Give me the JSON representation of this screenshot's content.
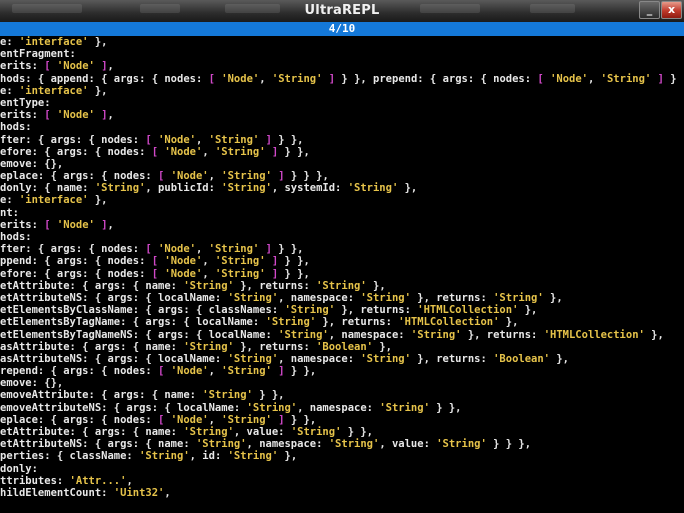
{
  "window": {
    "title": "UltraREPL",
    "minimize_glyph": "_",
    "close_glyph": "x"
  },
  "pager": {
    "label": "4/10"
  },
  "colors": {
    "text": "#e8e8e8",
    "string": "#e6c34a",
    "bracket": "#d048c8",
    "pager": "#1478d8"
  },
  "lines": [
    [
      {
        "t": "e: ",
        "c": "k"
      },
      {
        "t": "'interface'",
        "c": "s"
      },
      {
        "t": " },",
        "c": "p"
      }
    ],
    [
      {
        "t": "entFragment:",
        "c": "k"
      }
    ],
    [
      {
        "t": "erits: ",
        "c": "k"
      },
      {
        "t": "[",
        "c": "b"
      },
      {
        "t": " ",
        "c": "p"
      },
      {
        "t": "'Node'",
        "c": "s"
      },
      {
        "t": " ",
        "c": "p"
      },
      {
        "t": "]",
        "c": "b"
      },
      {
        "t": ",",
        "c": "p"
      }
    ],
    [
      {
        "t": "hods: { append: { args: { nodes: ",
        "c": "k"
      },
      {
        "t": "[",
        "c": "b"
      },
      {
        "t": " ",
        "c": "p"
      },
      {
        "t": "'Node'",
        "c": "s"
      },
      {
        "t": ", ",
        "c": "p"
      },
      {
        "t": "'String'",
        "c": "s"
      },
      {
        "t": " ",
        "c": "p"
      },
      {
        "t": "]",
        "c": "b"
      },
      {
        "t": " } }, prepend: { args: { nodes: ",
        "c": "k"
      },
      {
        "t": "[",
        "c": "b"
      },
      {
        "t": " ",
        "c": "p"
      },
      {
        "t": "'Node'",
        "c": "s"
      },
      {
        "t": ", ",
        "c": "p"
      },
      {
        "t": "'String'",
        "c": "s"
      },
      {
        "t": " ",
        "c": "p"
      },
      {
        "t": "]",
        "c": "b"
      },
      {
        "t": " }",
        "c": "p"
      }
    ],
    [
      {
        "t": "e: ",
        "c": "k"
      },
      {
        "t": "'interface'",
        "c": "s"
      },
      {
        "t": " },",
        "c": "p"
      }
    ],
    [
      {
        "t": "entType:",
        "c": "k"
      }
    ],
    [
      {
        "t": "erits: ",
        "c": "k"
      },
      {
        "t": "[",
        "c": "b"
      },
      {
        "t": " ",
        "c": "p"
      },
      {
        "t": "'Node'",
        "c": "s"
      },
      {
        "t": " ",
        "c": "p"
      },
      {
        "t": "]",
        "c": "b"
      },
      {
        "t": ",",
        "c": "p"
      }
    ],
    [
      {
        "t": "hods:",
        "c": "k"
      }
    ],
    [
      {
        "t": "fter: { args: { nodes: ",
        "c": "k"
      },
      {
        "t": "[",
        "c": "b"
      },
      {
        "t": " ",
        "c": "p"
      },
      {
        "t": "'Node'",
        "c": "s"
      },
      {
        "t": ", ",
        "c": "p"
      },
      {
        "t": "'String'",
        "c": "s"
      },
      {
        "t": " ",
        "c": "p"
      },
      {
        "t": "]",
        "c": "b"
      },
      {
        "t": " } },",
        "c": "p"
      }
    ],
    [
      {
        "t": "efore: { args: { nodes: ",
        "c": "k"
      },
      {
        "t": "[",
        "c": "b"
      },
      {
        "t": " ",
        "c": "p"
      },
      {
        "t": "'Node'",
        "c": "s"
      },
      {
        "t": ", ",
        "c": "p"
      },
      {
        "t": "'String'",
        "c": "s"
      },
      {
        "t": " ",
        "c": "p"
      },
      {
        "t": "]",
        "c": "b"
      },
      {
        "t": " } },",
        "c": "p"
      }
    ],
    [
      {
        "t": "emove: {},",
        "c": "k"
      }
    ],
    [
      {
        "t": "eplace: { args: { nodes: ",
        "c": "k"
      },
      {
        "t": "[",
        "c": "b"
      },
      {
        "t": " ",
        "c": "p"
      },
      {
        "t": "'Node'",
        "c": "s"
      },
      {
        "t": ", ",
        "c": "p"
      },
      {
        "t": "'String'",
        "c": "s"
      },
      {
        "t": " ",
        "c": "p"
      },
      {
        "t": "]",
        "c": "b"
      },
      {
        "t": " } } },",
        "c": "p"
      }
    ],
    [
      {
        "t": "donly: { name: ",
        "c": "k"
      },
      {
        "t": "'String'",
        "c": "s"
      },
      {
        "t": ", publicId: ",
        "c": "p"
      },
      {
        "t": "'String'",
        "c": "s"
      },
      {
        "t": ", systemId: ",
        "c": "p"
      },
      {
        "t": "'String'",
        "c": "s"
      },
      {
        "t": " },",
        "c": "p"
      }
    ],
    [
      {
        "t": "e: ",
        "c": "k"
      },
      {
        "t": "'interface'",
        "c": "s"
      },
      {
        "t": " },",
        "c": "p"
      }
    ],
    [
      {
        "t": "nt:",
        "c": "k"
      }
    ],
    [
      {
        "t": "erits: ",
        "c": "k"
      },
      {
        "t": "[",
        "c": "b"
      },
      {
        "t": " ",
        "c": "p"
      },
      {
        "t": "'Node'",
        "c": "s"
      },
      {
        "t": " ",
        "c": "p"
      },
      {
        "t": "]",
        "c": "b"
      },
      {
        "t": ",",
        "c": "p"
      }
    ],
    [
      {
        "t": "hods:",
        "c": "k"
      }
    ],
    [
      {
        "t": "fter: { args: { nodes: ",
        "c": "k"
      },
      {
        "t": "[",
        "c": "b"
      },
      {
        "t": " ",
        "c": "p"
      },
      {
        "t": "'Node'",
        "c": "s"
      },
      {
        "t": ", ",
        "c": "p"
      },
      {
        "t": "'String'",
        "c": "s"
      },
      {
        "t": " ",
        "c": "p"
      },
      {
        "t": "]",
        "c": "b"
      },
      {
        "t": " } },",
        "c": "p"
      }
    ],
    [
      {
        "t": "ppend: { args: { nodes: ",
        "c": "k"
      },
      {
        "t": "[",
        "c": "b"
      },
      {
        "t": " ",
        "c": "p"
      },
      {
        "t": "'Node'",
        "c": "s"
      },
      {
        "t": ", ",
        "c": "p"
      },
      {
        "t": "'String'",
        "c": "s"
      },
      {
        "t": " ",
        "c": "p"
      },
      {
        "t": "]",
        "c": "b"
      },
      {
        "t": " } },",
        "c": "p"
      }
    ],
    [
      {
        "t": "efore: { args: { nodes: ",
        "c": "k"
      },
      {
        "t": "[",
        "c": "b"
      },
      {
        "t": " ",
        "c": "p"
      },
      {
        "t": "'Node'",
        "c": "s"
      },
      {
        "t": ", ",
        "c": "p"
      },
      {
        "t": "'String'",
        "c": "s"
      },
      {
        "t": " ",
        "c": "p"
      },
      {
        "t": "]",
        "c": "b"
      },
      {
        "t": " } },",
        "c": "p"
      }
    ],
    [
      {
        "t": "etAttribute: { args: { name: ",
        "c": "k"
      },
      {
        "t": "'String'",
        "c": "s"
      },
      {
        "t": " }, returns: ",
        "c": "p"
      },
      {
        "t": "'String'",
        "c": "s"
      },
      {
        "t": " },",
        "c": "p"
      }
    ],
    [
      {
        "t": "etAttributeNS: { args: { localName: ",
        "c": "k"
      },
      {
        "t": "'String'",
        "c": "s"
      },
      {
        "t": ", namespace: ",
        "c": "p"
      },
      {
        "t": "'String'",
        "c": "s"
      },
      {
        "t": " }, returns: ",
        "c": "p"
      },
      {
        "t": "'String'",
        "c": "s"
      },
      {
        "t": " },",
        "c": "p"
      }
    ],
    [
      {
        "t": "etElementsByClassName: { args: { classNames: ",
        "c": "k"
      },
      {
        "t": "'String'",
        "c": "s"
      },
      {
        "t": " }, returns: ",
        "c": "p"
      },
      {
        "t": "'HTMLCollection'",
        "c": "s"
      },
      {
        "t": " },",
        "c": "p"
      }
    ],
    [
      {
        "t": "etElementsByTagName: { args: { localName: ",
        "c": "k"
      },
      {
        "t": "'String'",
        "c": "s"
      },
      {
        "t": " }, returns: ",
        "c": "p"
      },
      {
        "t": "'HTMLCollection'",
        "c": "s"
      },
      {
        "t": " },",
        "c": "p"
      }
    ],
    [
      {
        "t": "etElementsByTagNameNS: { args: { localName: ",
        "c": "k"
      },
      {
        "t": "'String'",
        "c": "s"
      },
      {
        "t": ", namespace: ",
        "c": "p"
      },
      {
        "t": "'String'",
        "c": "s"
      },
      {
        "t": " }, returns: ",
        "c": "p"
      },
      {
        "t": "'HTMLCollection'",
        "c": "s"
      },
      {
        "t": " },",
        "c": "p"
      }
    ],
    [
      {
        "t": "asAttribute: { args: { name: ",
        "c": "k"
      },
      {
        "t": "'String'",
        "c": "s"
      },
      {
        "t": " }, returns: ",
        "c": "p"
      },
      {
        "t": "'Boolean'",
        "c": "s"
      },
      {
        "t": " },",
        "c": "p"
      }
    ],
    [
      {
        "t": "asAttributeNS: { args: { localName: ",
        "c": "k"
      },
      {
        "t": "'String'",
        "c": "s"
      },
      {
        "t": ", namespace: ",
        "c": "p"
      },
      {
        "t": "'String'",
        "c": "s"
      },
      {
        "t": " }, returns: ",
        "c": "p"
      },
      {
        "t": "'Boolean'",
        "c": "s"
      },
      {
        "t": " },",
        "c": "p"
      }
    ],
    [
      {
        "t": "repend: { args: { nodes: ",
        "c": "k"
      },
      {
        "t": "[",
        "c": "b"
      },
      {
        "t": " ",
        "c": "p"
      },
      {
        "t": "'Node'",
        "c": "s"
      },
      {
        "t": ", ",
        "c": "p"
      },
      {
        "t": "'String'",
        "c": "s"
      },
      {
        "t": " ",
        "c": "p"
      },
      {
        "t": "]",
        "c": "b"
      },
      {
        "t": " } },",
        "c": "p"
      }
    ],
    [
      {
        "t": "emove: {},",
        "c": "k"
      }
    ],
    [
      {
        "t": "emoveAttribute: { args: { name: ",
        "c": "k"
      },
      {
        "t": "'String'",
        "c": "s"
      },
      {
        "t": " } },",
        "c": "p"
      }
    ],
    [
      {
        "t": "emoveAttributeNS: { args: { localName: ",
        "c": "k"
      },
      {
        "t": "'String'",
        "c": "s"
      },
      {
        "t": ", namespace: ",
        "c": "p"
      },
      {
        "t": "'String'",
        "c": "s"
      },
      {
        "t": " } },",
        "c": "p"
      }
    ],
    [
      {
        "t": "eplace: { args: { nodes: ",
        "c": "k"
      },
      {
        "t": "[",
        "c": "b"
      },
      {
        "t": " ",
        "c": "p"
      },
      {
        "t": "'Node'",
        "c": "s"
      },
      {
        "t": ", ",
        "c": "p"
      },
      {
        "t": "'String'",
        "c": "s"
      },
      {
        "t": " ",
        "c": "p"
      },
      {
        "t": "]",
        "c": "b"
      },
      {
        "t": " } },",
        "c": "p"
      }
    ],
    [
      {
        "t": "etAttribute: { args: { name: ",
        "c": "k"
      },
      {
        "t": "'String'",
        "c": "s"
      },
      {
        "t": ", value: ",
        "c": "p"
      },
      {
        "t": "'String'",
        "c": "s"
      },
      {
        "t": " } },",
        "c": "p"
      }
    ],
    [
      {
        "t": "etAttributeNS: { args: { name: ",
        "c": "k"
      },
      {
        "t": "'String'",
        "c": "s"
      },
      {
        "t": ", namespace: ",
        "c": "p"
      },
      {
        "t": "'String'",
        "c": "s"
      },
      {
        "t": ", value: ",
        "c": "p"
      },
      {
        "t": "'String'",
        "c": "s"
      },
      {
        "t": " } } },",
        "c": "p"
      }
    ],
    [
      {
        "t": "perties: { className: ",
        "c": "k"
      },
      {
        "t": "'String'",
        "c": "s"
      },
      {
        "t": ", id: ",
        "c": "p"
      },
      {
        "t": "'String'",
        "c": "s"
      },
      {
        "t": " },",
        "c": "p"
      }
    ],
    [
      {
        "t": "donly:",
        "c": "k"
      }
    ],
    [
      {
        "t": "ttributes: ",
        "c": "k"
      },
      {
        "t": "'Attr...'",
        "c": "s"
      },
      {
        "t": ",",
        "c": "p"
      }
    ],
    [
      {
        "t": "hildElementCount: ",
        "c": "k"
      },
      {
        "t": "'Uint32'",
        "c": "s"
      },
      {
        "t": ",",
        "c": "p"
      }
    ]
  ]
}
